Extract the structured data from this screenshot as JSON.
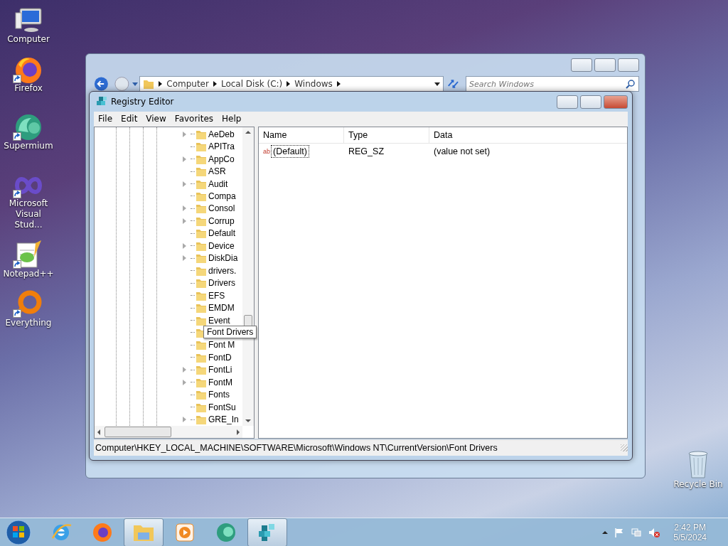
{
  "desktop_icons": [
    {
      "label": "Computer",
      "kind": "computer",
      "shortcut": false
    },
    {
      "label": "Firefox",
      "kind": "firefox",
      "shortcut": true
    },
    {
      "label": "Supermium",
      "kind": "supermium",
      "shortcut": true
    },
    {
      "label": "Microsoft Visual Stud...",
      "kind": "vs",
      "shortcut": true
    },
    {
      "label": "Notepad++",
      "kind": "notepad",
      "shortcut": true
    },
    {
      "label": "Everything",
      "kind": "everything",
      "shortcut": true
    }
  ],
  "recycle_bin": {
    "label": "Recycle Bin"
  },
  "explorer_window": {
    "breadcrumb": [
      "Computer",
      "Local Disk (C:)",
      "Windows"
    ],
    "search": {
      "placeholder": "Search Windows"
    }
  },
  "registry_editor": {
    "title": "Registry Editor",
    "menu": [
      "File",
      "Edit",
      "View",
      "Favorites",
      "Help"
    ],
    "tree": [
      {
        "label": "AeDeb",
        "has_children": true
      },
      {
        "label": "APITra",
        "has_children": false
      },
      {
        "label": "AppCo",
        "has_children": true
      },
      {
        "label": "ASR",
        "has_children": false
      },
      {
        "label": "Audit",
        "has_children": true
      },
      {
        "label": "Compa",
        "has_children": false
      },
      {
        "label": "Consol",
        "has_children": true
      },
      {
        "label": "Corrup",
        "has_children": true
      },
      {
        "label": "Default",
        "has_children": false
      },
      {
        "label": "Device",
        "has_children": true
      },
      {
        "label": "DiskDia",
        "has_children": true
      },
      {
        "label": "drivers.",
        "has_children": false
      },
      {
        "label": "Drivers",
        "has_children": false
      },
      {
        "label": "EFS",
        "has_children": false
      },
      {
        "label": "EMDM",
        "has_children": false
      },
      {
        "label": "Event",
        "has_children": false
      },
      {
        "has_children": false,
        "tooltip": "Font Drivers"
      },
      {
        "label": "Font M",
        "has_children": false
      },
      {
        "label": "FontD",
        "has_children": false
      },
      {
        "label": "FontLi",
        "has_children": true
      },
      {
        "label": "FontM",
        "has_children": true
      },
      {
        "label": "Fonts",
        "has_children": false
      },
      {
        "label": "FontSu",
        "has_children": false
      },
      {
        "label": "GRE_In",
        "has_children": true
      }
    ],
    "columns": [
      "Name",
      "Type",
      "Data"
    ],
    "values": [
      {
        "icon_text": "ab",
        "name": "(Default)",
        "type": "REG_SZ",
        "data": "(value not set)",
        "selected": true
      }
    ],
    "status_bar": "Computer\\HKEY_LOCAL_MACHINE\\SOFTWARE\\Microsoft\\Windows NT\\CurrentVersion\\Font Drivers"
  },
  "taskbar": {
    "apps": [
      {
        "kind": "ie",
        "active": false
      },
      {
        "kind": "firefox",
        "active": false
      },
      {
        "kind": "explorer",
        "active": true
      },
      {
        "kind": "media",
        "active": false
      },
      {
        "kind": "supermium",
        "active": false
      },
      {
        "kind": "regedit",
        "active": true
      }
    ],
    "clock": {
      "time": "2:42 PM",
      "date": "5/5/2024"
    }
  }
}
